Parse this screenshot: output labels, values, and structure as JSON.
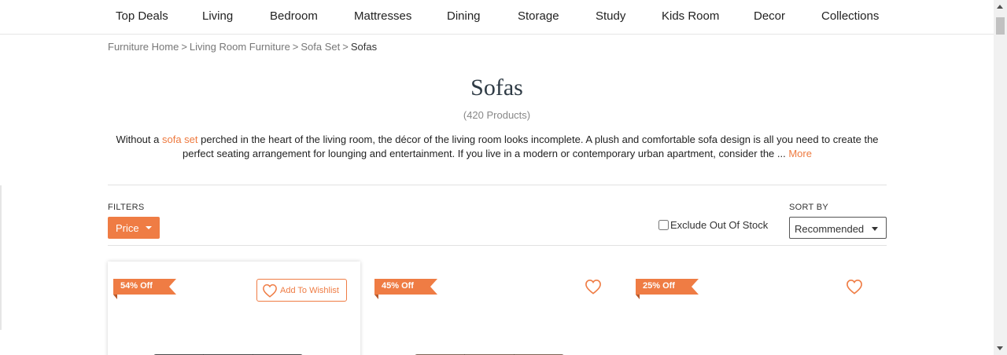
{
  "nav": {
    "items": [
      "Top Deals",
      "Living",
      "Bedroom",
      "Mattresses",
      "Dining",
      "Storage",
      "Study",
      "Kids Room",
      "Decor",
      "Collections"
    ]
  },
  "breadcrumb": {
    "items": [
      "Furniture Home",
      "Living Room Furniture",
      "Sofa Set"
    ],
    "separator": ">",
    "current": "Sofas"
  },
  "page": {
    "title": "Sofas",
    "count": "(420 Products)"
  },
  "description": {
    "prefix": "Without a ",
    "link": "sofa set",
    "body": " perched in the heart of the living room, the décor of the living room looks incomplete. A plush and comfortable sofa design is all you need to create the perfect seating arrangement for lounging and entertainment. If you live in a modern or contemporary urban apartment, consider the ... ",
    "more": "More"
  },
  "filters": {
    "label": "FILTERS",
    "price_label": "Price",
    "exclude_label": "Exclude Out Of Stock",
    "exclude_checked": false
  },
  "sort": {
    "label": "SORT BY",
    "selected": "Recommended"
  },
  "products": [
    {
      "discount": "54% Off",
      "wishlist_label": "Add To Wishlist",
      "sofa_color": "#4a4a4a"
    },
    {
      "discount": "45% Off",
      "sofa_color": "#7d6454"
    },
    {
      "discount": "25% Off"
    }
  ],
  "colors": {
    "accent": "#ef7c44",
    "title": "#2f3b45"
  },
  "icons": {
    "wishlist": "heart-outline-icon",
    "dropdown": "caret-down-icon"
  }
}
